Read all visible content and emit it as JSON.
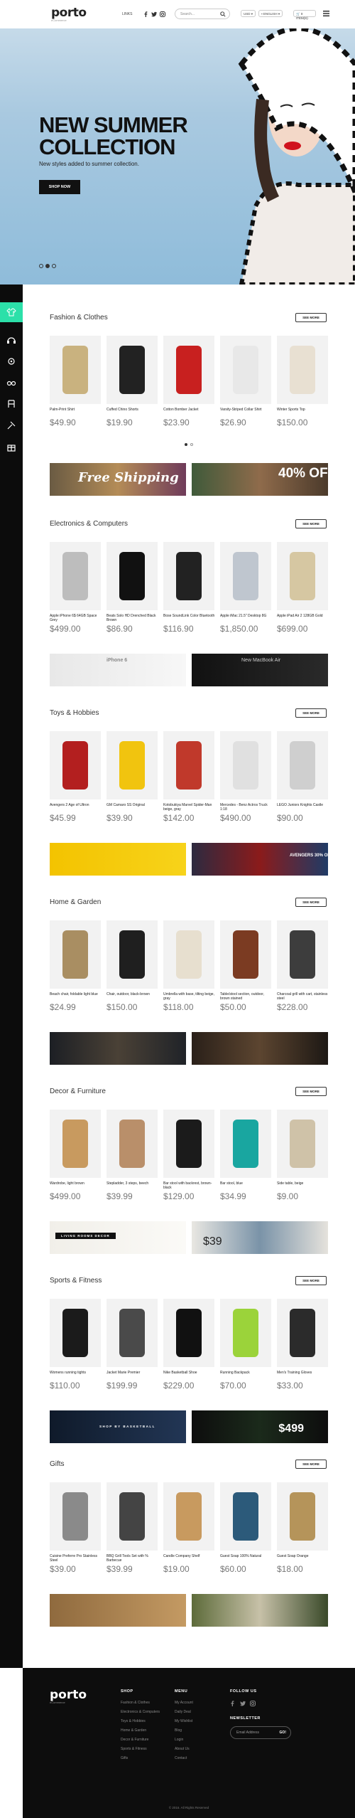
{
  "header": {
    "logo": "porto",
    "logo_sub": "eCommerce",
    "links": "LINKS",
    "search_placeholder": "Search...",
    "currency": "USD",
    "language": "ENGLISH",
    "cart": "0 ITEM(S)"
  },
  "hero": {
    "title": "NEW SUMMER COLLECTION",
    "subtitle": "New styles added to summer collection.",
    "button": "SHOP NOW"
  },
  "more_label": "SEE MORE",
  "sections": [
    {
      "title": "Fashion & Clothes",
      "products": [
        {
          "name": "Palm-Print Shirt",
          "price": "$49.90"
        },
        {
          "name": "Cuffed Chino Shorts",
          "price": "$19.90"
        },
        {
          "name": "Cotton Bomber Jacket",
          "price": "$23.90"
        },
        {
          "name": "Varsity-Striped Collar Shirt",
          "price": "$26.90"
        },
        {
          "name": "Winter Sports Top",
          "price": "$150.00"
        }
      ],
      "banners": [
        "Free Shipping",
        "40% OFF"
      ]
    },
    {
      "title": "Electronics & Computers",
      "products": [
        {
          "name": "Apple iPhone 6$ 64GB Space Grey",
          "price": "$499.00"
        },
        {
          "name": "Beats Solo HD Drenched Black Brown",
          "price": "$86.90"
        },
        {
          "name": "Bose SoundLink Color Bluetooth",
          "price": "$116.90"
        },
        {
          "name": "Apple iMac 21.5\" Desktop 8G",
          "price": "$1,850.00"
        },
        {
          "name": "Apple iPad Air 2 128GB Gold",
          "price": "$699.00"
        }
      ],
      "banners": [
        "iPhone 6",
        "New MacBook Air"
      ]
    },
    {
      "title": "Toys & Hobbies",
      "products": [
        {
          "name": "Avengers 2 Age of Ultron",
          "price": "$45.99"
        },
        {
          "name": "GM Camaro SS Original",
          "price": "$39.90"
        },
        {
          "name": "Kotobukiya Marvel Spider-Man beige, gray",
          "price": "$142.00"
        },
        {
          "name": "Mercedes - Benz Actros Truck 1:18",
          "price": "$490.00"
        },
        {
          "name": "LEGO Juniors Knights Castle",
          "price": "$90.00"
        }
      ],
      "banners": [
        "",
        "AVENGERS 30% OFF"
      ]
    },
    {
      "title": "Home & Garden",
      "products": [
        {
          "name": "Beach chair, foldable light blue",
          "price": "$24.99"
        },
        {
          "name": "Chair, outdoor, black-brown",
          "price": "$150.00"
        },
        {
          "name": "Umbrella with base, tilting beige, gray",
          "price": "$118.00"
        },
        {
          "name": "Table/stool section, outdoor, brown stained",
          "price": "$50.00"
        },
        {
          "name": "Charcoal grill with cart, stainless steel",
          "price": "$228.00"
        }
      ],
      "banners": [
        "",
        ""
      ]
    },
    {
      "title": "Decor & Furniture",
      "products": [
        {
          "name": "Wardrobe, light brown",
          "price": "$499.00"
        },
        {
          "name": "Stepladder, 3 steps, beech",
          "price": "$39.99"
        },
        {
          "name": "Bar stool with backrest, brown-black",
          "price": "$129.00"
        },
        {
          "name": "Bar stool, blue",
          "price": "$34.99"
        },
        {
          "name": "Side table, beige",
          "price": "$9.00"
        }
      ],
      "banners": [
        "LIVING ROOMS DECOR",
        "$39"
      ]
    },
    {
      "title": "Sports & Fitness",
      "products": [
        {
          "name": "Womens running tights",
          "price": "$110.00"
        },
        {
          "name": "Jacket Marie Premier",
          "price": "$199.99"
        },
        {
          "name": "Nike Basketball Shoe",
          "price": "$229.00"
        },
        {
          "name": "Running Backpack",
          "price": "$70.00"
        },
        {
          "name": "Men's Training Gloves",
          "price": "$33.00"
        }
      ],
      "banners": [
        "SHOP BY BASKETBALL",
        "$499"
      ]
    },
    {
      "title": "Gifts",
      "products": [
        {
          "name": "Cuisine Preferre Pro Stainless Steel",
          "price": "$39.00"
        },
        {
          "name": "BBQ Grill Tools Set with % Barbecue",
          "price": "$39.99"
        },
        {
          "name": "Candle Company Shelf",
          "price": "$19.00"
        },
        {
          "name": "Guest Soap 100% Natural",
          "price": "$60.00"
        },
        {
          "name": "Guest Soap Orange",
          "price": "$18.00"
        }
      ],
      "banners": [
        "",
        ""
      ]
    }
  ],
  "footer": {
    "logo": "porto",
    "logo_sub": "eCommerce",
    "shop_head": "SHOP",
    "shop_links": [
      "Fashion & Clothes",
      "Electronics & Computers",
      "Toys & Hobbies",
      "Home & Garden",
      "Decor & Furniture",
      "Sports & Fitness",
      "Gifts"
    ],
    "menu_head": "MENU",
    "menu_links": [
      "My Account",
      "Daily Deal",
      "My Wishlist",
      "Blog",
      "Login",
      "About Us",
      "Contact"
    ],
    "follow_head": "FOLLOW US",
    "news_head": "NEWSLETTER",
    "news_placeholder": "Email Address",
    "news_button": "GO!",
    "copyright": "© 2016. All Rights Reserved"
  },
  "colors": {
    "accent": "#2ce0a9",
    "rail": "#0c0c0c",
    "footer": "#0d0d0d"
  }
}
